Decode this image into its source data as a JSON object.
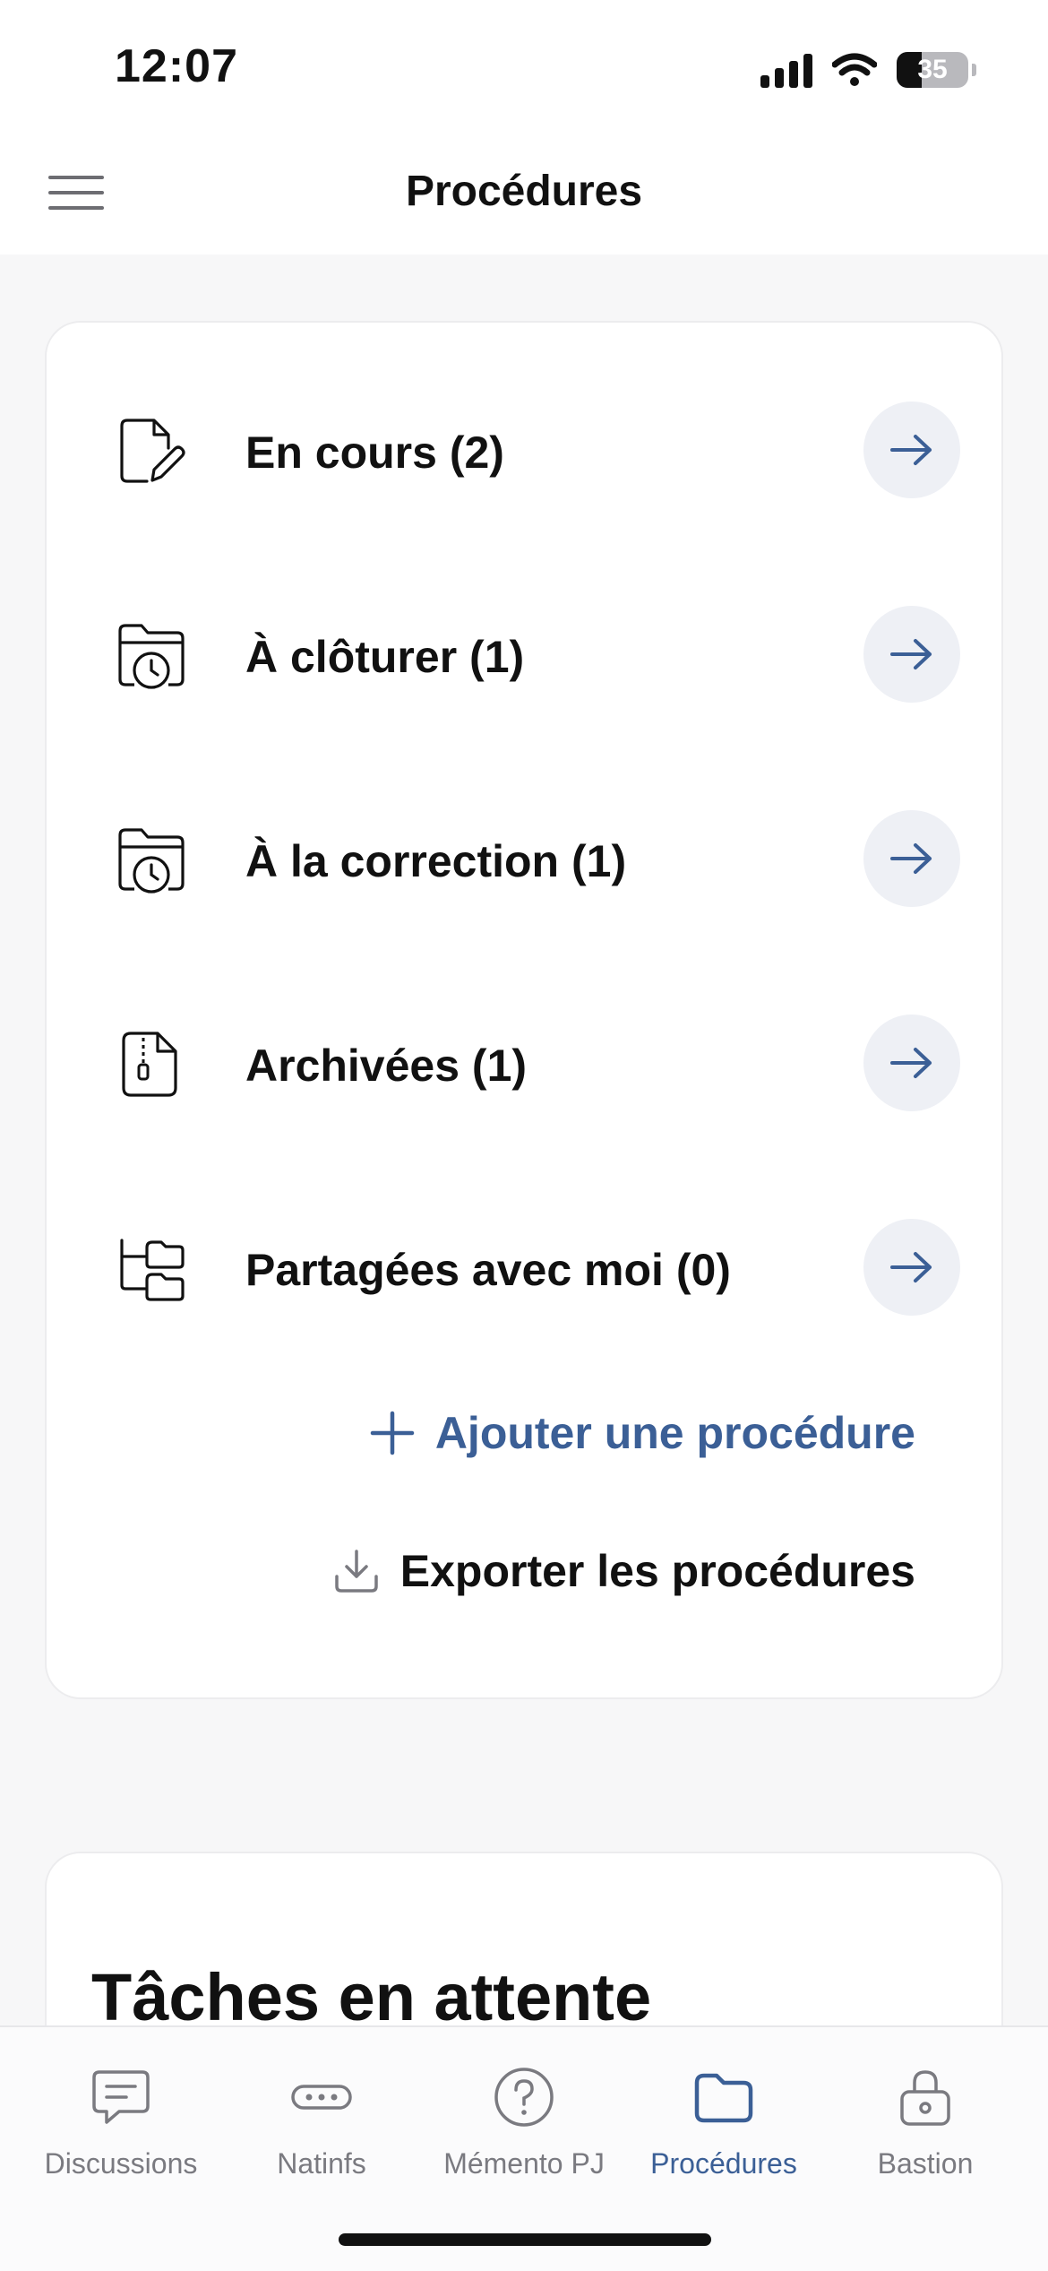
{
  "status_bar": {
    "time": "12:07",
    "battery": "35"
  },
  "header": {
    "title": "Procédures",
    "menu_icon": "hamburger-menu-icon"
  },
  "procedures": {
    "items": [
      {
        "label": "En cours (2)",
        "icon": "document-edit-icon"
      },
      {
        "label": "À clôturer (1)",
        "icon": "folder-clock-icon"
      },
      {
        "label": "À la correction (1)",
        "icon": "folder-clock-icon"
      },
      {
        "label": "Archivées (1)",
        "icon": "archive-zip-file-icon"
      },
      {
        "label": "Partagées avec moi (0)",
        "icon": "shared-folders-icon"
      }
    ],
    "add_label": "Ajouter une procédure",
    "export_label": "Exporter les procédures"
  },
  "tasks": {
    "title": "Tâches en attente"
  },
  "tabbar": {
    "tabs": [
      {
        "label": "Discussions",
        "icon": "chat-bubble-icon"
      },
      {
        "label": "Natinfs",
        "icon": "dots-pill-icon"
      },
      {
        "label": "Mémento PJ",
        "icon": "question-circle-icon"
      },
      {
        "label": "Procédures",
        "icon": "folder-icon",
        "active": true
      },
      {
        "label": "Bastion",
        "icon": "lock-icon"
      }
    ]
  },
  "colors": {
    "accent": "#3b5f96",
    "arrow_button_bg": "#eef0f5",
    "text": "#111111",
    "inactive_tab": "#7a7a80"
  }
}
